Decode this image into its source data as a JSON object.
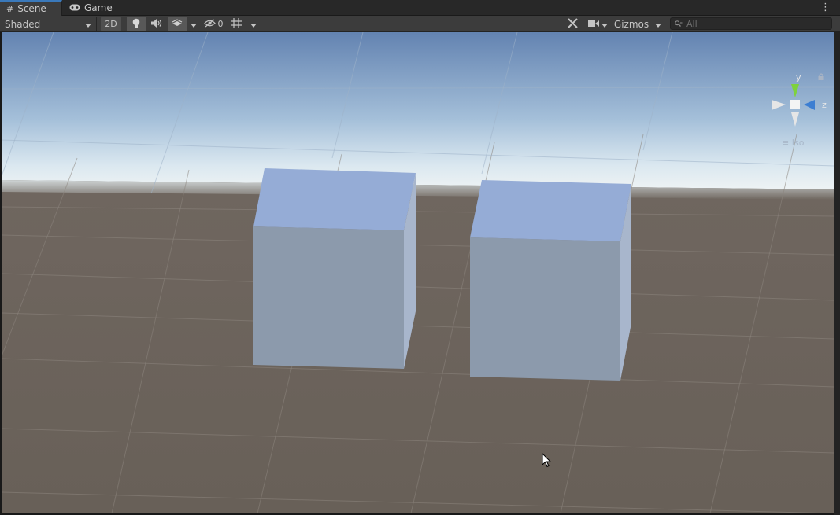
{
  "tabs": [
    {
      "label": "Scene",
      "icon": "grid-icon",
      "active": true
    },
    {
      "label": "Game",
      "icon": "gamepad-icon",
      "active": false
    }
  ],
  "toolbar": {
    "shading_mode": "Shaded",
    "mode_2d_label": "2D",
    "hidden_count": "0",
    "gizmos_label": "Gizmos",
    "search_placeholder": "All"
  },
  "gizmo": {
    "y_label": "y",
    "z_label": "z",
    "projection_label": "Iso",
    "colors": {
      "y": "#7ed23c",
      "z": "#3c7ed2",
      "x": "#e8e8e8"
    }
  },
  "scene": {
    "objects": [
      "cube",
      "cube"
    ],
    "sky_color_top": "#6784b3",
    "horizon_color": "#e4eef4",
    "ground_color": "#6a615a",
    "cube_front_color": "#8c9bb0",
    "cube_top_color": "#95acd6"
  }
}
